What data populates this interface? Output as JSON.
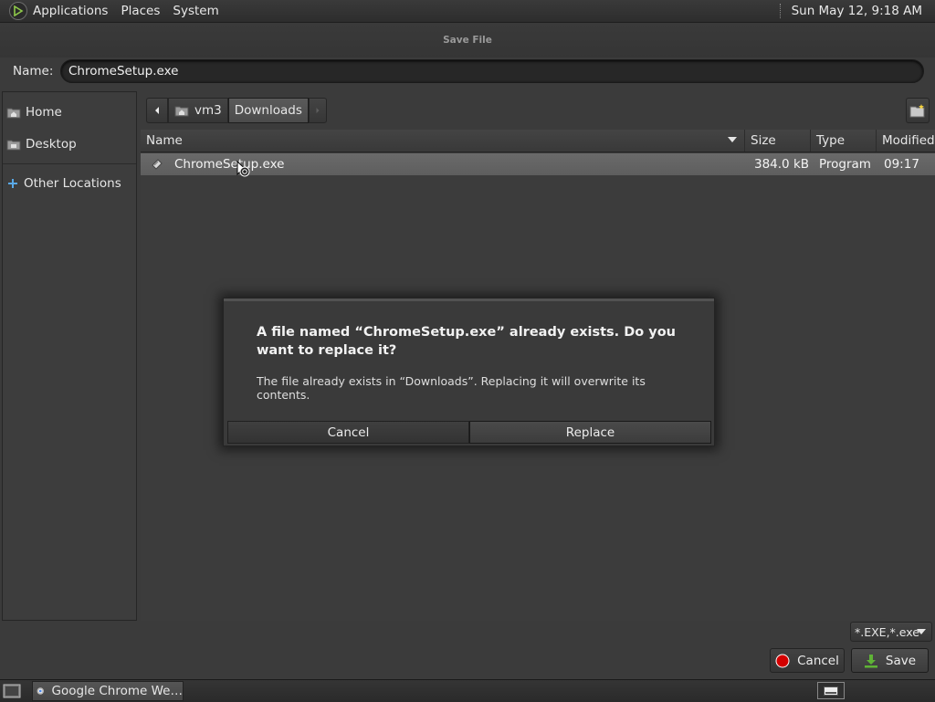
{
  "top_panel": {
    "menus": [
      "Applications",
      "Places",
      "System"
    ],
    "clock": "Sun May 12,  9:18 AM"
  },
  "dialog": {
    "title": "Save File",
    "name_label": "Name:",
    "name_value": "ChromeSetup.exe"
  },
  "sidebar": {
    "items": [
      {
        "label": "Home",
        "icon": "home-folder-icon"
      },
      {
        "label": "Desktop",
        "icon": "desktop-folder-icon"
      },
      {
        "label": "Other Locations",
        "icon": "plus-icon"
      }
    ]
  },
  "path_bar": {
    "segments": [
      "vm3",
      "Downloads"
    ],
    "active": "Downloads"
  },
  "file_list": {
    "columns": [
      "Name",
      "Size",
      "Type",
      "Modified"
    ],
    "rows": [
      {
        "name": "ChromeSetup.exe",
        "size": "384.0 kB",
        "type": "Program",
        "modified": "09:17"
      }
    ]
  },
  "filter": {
    "selected": "*.EXE,*.exe"
  },
  "buttons": {
    "cancel": "Cancel",
    "save": "Save"
  },
  "modal": {
    "heading": "A file named “ChromeSetup.exe” already exists.  Do you want to replace it?",
    "body": "The file already exists in “Downloads”.  Replacing it will overwrite its contents.",
    "cancel": "Cancel",
    "replace": "Replace"
  },
  "taskbar": {
    "task_label": "Google Chrome We…"
  },
  "colors": {
    "background": "#3b3b3b",
    "selection": "#646464",
    "cancel_red": "#d40000",
    "save_green": "#5fb336"
  }
}
